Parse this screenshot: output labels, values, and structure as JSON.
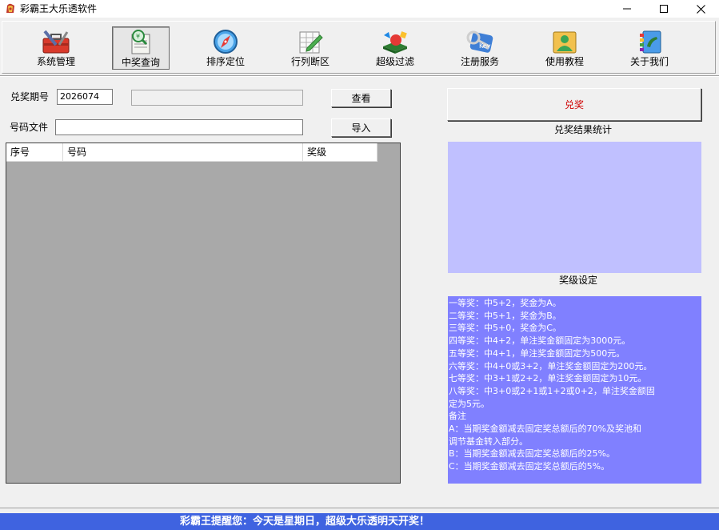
{
  "window": {
    "title": "彩霸王大乐透软件",
    "minimize_icon": "minimize-icon",
    "maximize_icon": "maximize-icon",
    "close_icon": "close-icon"
  },
  "toolbar": {
    "items": [
      {
        "label": "系统管理",
        "icon": "toolbox-icon",
        "active": false
      },
      {
        "label": "中奖查询",
        "icon": "lottery-ticket-icon",
        "active": true
      },
      {
        "label": "排序定位",
        "icon": "compass-icon",
        "active": false
      },
      {
        "label": "行列断区",
        "icon": "grid-pencil-icon",
        "active": false
      },
      {
        "label": "超级过滤",
        "icon": "filter-shapes-icon",
        "active": false
      },
      {
        "label": "注册服务",
        "icon": "key-icon",
        "active": false
      },
      {
        "label": "使用教程",
        "icon": "user-book-icon",
        "active": false
      },
      {
        "label": "关于我们",
        "icon": "phone-book-icon",
        "active": false
      }
    ]
  },
  "query": {
    "period_label": "兑奖期号",
    "period_value": "2026074",
    "extra_value": "",
    "view_button": "查看",
    "file_label": "号码文件",
    "file_value": "",
    "import_button": "导入"
  },
  "table": {
    "columns": [
      "序号",
      "号码",
      "奖级"
    ],
    "rows": []
  },
  "right": {
    "redeem_button": "兑奖",
    "stats_caption": "兑奖结果统计",
    "rules_caption": "奖级设定",
    "rules_text": "一等奖：中5+2，奖金为A。\n二等奖：中5+1，奖金为B。\n三等奖：中5+0，奖金为C。\n四等奖：中4+2，单注奖金额固定为3000元。\n五等奖：中4+1，单注奖金额固定为500元。\n六等奖：中4+0或3+2，单注奖金额固定为200元。\n七等奖：中3+1或2+2，单注奖金额固定为10元。\n八等奖：中3+0或2+1或1+2或0+2，单注奖金额固\n定为5元。\n备注\nA：当期奖金额减去固定奖总额后的70%及奖池和\n调节基金转入部分。\nB：当期奖金额减去固定奖总额后的25%。\nC：当期奖金额减去固定奖总额后的5%。"
  },
  "status": {
    "message": "彩霸王提醒您：今天是星期日，超级大乐透明天开奖！"
  },
  "colors": {
    "stats_bg": "#c0c0ff",
    "rules_bg": "#8080ff",
    "status_bg": "#3f63e0",
    "redeem_text": "#d00000"
  }
}
